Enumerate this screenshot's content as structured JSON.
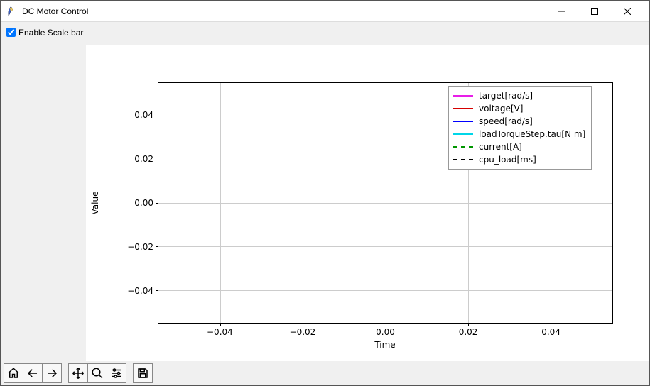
{
  "window": {
    "title": "DC Motor Control"
  },
  "controls": {
    "enable_scale_bar_label": "Enable Scale bar",
    "enable_scale_bar_checked": true
  },
  "chart_data": {
    "type": "line",
    "title": "",
    "xlabel": "Time",
    "ylabel": "Value",
    "xlim": [
      -0.055,
      0.055
    ],
    "ylim": [
      -0.055,
      0.055
    ],
    "xticks": [
      -0.04,
      -0.02,
      0.0,
      0.02,
      0.04
    ],
    "yticks": [
      -0.04,
      -0.02,
      0.0,
      0.02,
      0.04
    ],
    "xtick_labels": [
      "−0.04",
      "−0.02",
      "0.00",
      "0.02",
      "0.04"
    ],
    "ytick_labels": [
      "−0.04",
      "−0.02",
      "0.00",
      "0.02",
      "0.04"
    ],
    "grid": true,
    "legend_position": "upper right",
    "series": [
      {
        "name": "target[rad/s]",
        "color": "#e81ee8",
        "linewidth": 3,
        "linestyle": "solid",
        "x": [],
        "y": []
      },
      {
        "name": "voltage[V]",
        "color": "#d60000",
        "linewidth": 1.5,
        "linestyle": "solid",
        "x": [],
        "y": []
      },
      {
        "name": "speed[rad/s]",
        "color": "#0000ff",
        "linewidth": 1.5,
        "linestyle": "solid",
        "x": [],
        "y": []
      },
      {
        "name": "loadTorqueStep.tau[N m]",
        "color": "#00d6e8",
        "linewidth": 1.5,
        "linestyle": "solid",
        "x": [],
        "y": []
      },
      {
        "name": "current[A]",
        "color": "#009600",
        "linewidth": 1.5,
        "linestyle": "dashed",
        "x": [],
        "y": []
      },
      {
        "name": "cpu_load[ms]",
        "color": "#000000",
        "linewidth": 1.5,
        "linestyle": "dashed",
        "x": [],
        "y": []
      }
    ]
  },
  "toolbar": {
    "home": "Home",
    "back": "Back",
    "forward": "Forward",
    "pan": "Pan",
    "zoom": "Zoom",
    "subplots": "Configure subplots",
    "save": "Save figure"
  }
}
